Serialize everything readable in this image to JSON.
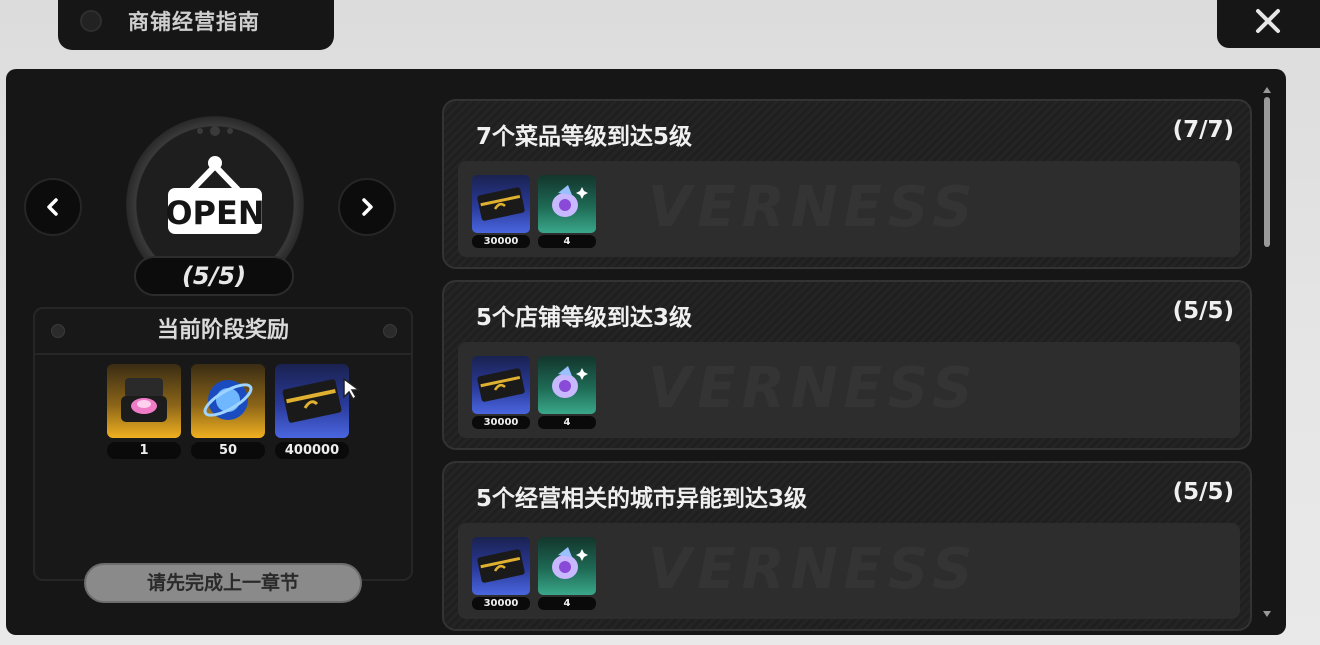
{
  "header": {
    "title": "商铺经营指南"
  },
  "close": {
    "icon": "close-icon"
  },
  "chapter": {
    "sign_text": "OPEN",
    "progress": "(5/5)",
    "prev_icon": "chevron-left-icon",
    "next_icon": "chevron-right-icon"
  },
  "stage_reward": {
    "title": "当前阶段奖励",
    "items": [
      {
        "icon": "jewel-box-icon",
        "count": "1",
        "rarity_color": "#f0b020"
      },
      {
        "icon": "blue-orb-icon",
        "count": "50",
        "rarity_color": "#f0b020"
      },
      {
        "icon": "gold-ticket-icon",
        "count": "400000",
        "rarity_color": "#4a66e0"
      }
    ]
  },
  "prev_chapter_button": "请先完成上一章节",
  "tasks": [
    {
      "title": "7个菜品等级到达5级",
      "progress": "(7/7)",
      "rewards": [
        {
          "icon": "gold-ticket-icon",
          "count": "30000"
        },
        {
          "icon": "purple-fish-icon",
          "count": "4"
        }
      ]
    },
    {
      "title": "5个店铺等级到达3级",
      "progress": "(5/5)",
      "rewards": [
        {
          "icon": "gold-ticket-icon",
          "count": "30000"
        },
        {
          "icon": "purple-fish-icon",
          "count": "4"
        }
      ]
    },
    {
      "title": "5个经营相关的城市异能到达3级",
      "progress": "(5/5)",
      "rewards": [
        {
          "icon": "gold-ticket-icon",
          "count": "30000"
        },
        {
          "icon": "purple-fish-icon",
          "count": "4"
        }
      ]
    }
  ],
  "watermark": "VERNESS"
}
